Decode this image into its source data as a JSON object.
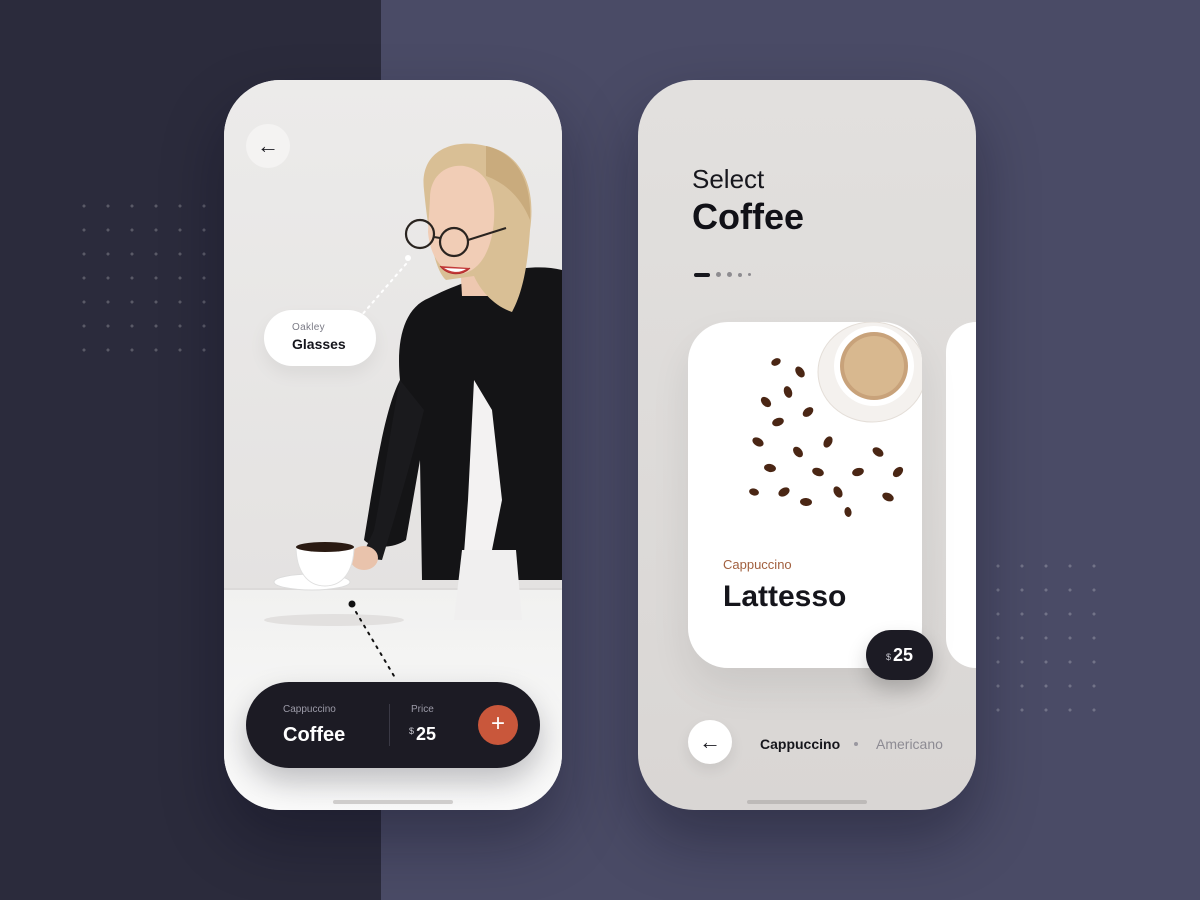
{
  "colors": {
    "background_left": "#2b2b3c",
    "background_right": "#4a4b66",
    "dark_bar": "#1c1b24",
    "accent_orange": "#c9573b",
    "card_subtitle_brown": "#a2603f"
  },
  "phone1": {
    "back_icon": "arrow-left-icon",
    "tag": {
      "small": "Oakley",
      "big": "Glasses"
    },
    "bar": {
      "product_sub": "Cappuccino",
      "product_title": "Coffee",
      "price_label": "Price",
      "currency": "$",
      "price": "25",
      "add_icon": "plus-icon",
      "add_symbol": "+"
    }
  },
  "phone2": {
    "heading_sub": "Select",
    "heading_title": "Coffee",
    "pager": {
      "count": 5,
      "active_index": 0
    },
    "card": {
      "subtitle": "Cappuccino",
      "title": "Lattesso",
      "currency": "$",
      "price": "25"
    },
    "back_icon": "arrow-left-icon",
    "categories": [
      {
        "label": "Cappuccino",
        "active": true
      },
      {
        "label": "Americano",
        "active": false
      }
    ]
  }
}
